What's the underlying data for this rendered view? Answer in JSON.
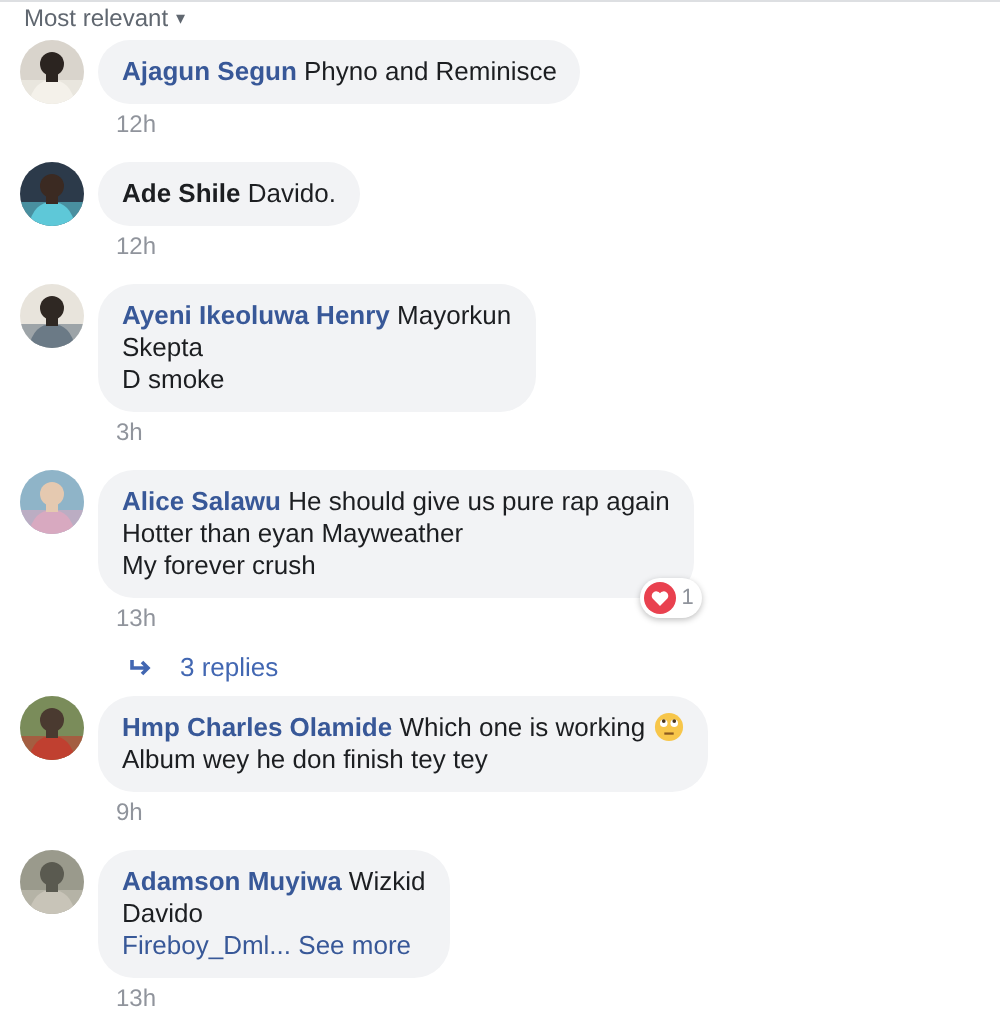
{
  "sort_menu": {
    "label": "Most relevant",
    "caret": "▾"
  },
  "comments": [
    {
      "author": "Ajagun Segun",
      "name_linked": true,
      "lines": [
        "Phyno and Reminisce"
      ],
      "time": "12h",
      "avatar": {
        "kind": "picture"
      }
    },
    {
      "author": "Ade Shile",
      "name_linked": false,
      "lines": [
        "Davido."
      ],
      "time": "12h",
      "avatar": {
        "kind": "picture"
      }
    },
    {
      "author": "Ayeni Ikeoluwa Henry",
      "name_linked": true,
      "lines": [
        "Mayorkun",
        "Skepta",
        "D smoke"
      ],
      "time": "3h",
      "avatar": {
        "kind": "picture"
      }
    },
    {
      "author": "Alice Salawu",
      "name_linked": true,
      "lines": [
        "He should give us pure rap again",
        "Hotter than eyan Mayweather",
        "My forever crush"
      ],
      "time": "13h",
      "reaction": {
        "count": "1"
      },
      "replies": "3 replies",
      "avatar": {
        "kind": "picture"
      }
    },
    {
      "author": "Hmp Charles Olamide",
      "name_linked": true,
      "lines": [
        "Which one is working",
        "Album wey he don finish tey tey"
      ],
      "emoji_after_first_line": true,
      "time": "9h",
      "avatar": {
        "kind": "picture"
      }
    },
    {
      "author": "Adamson Muyiwa",
      "name_linked": true,
      "lines": [
        "Wizkid",
        "Davido"
      ],
      "truncated": {
        "mention": "Fireboy_Dml...",
        "link": "See more"
      },
      "time": "13h",
      "avatar": {
        "kind": "picture"
      }
    }
  ]
}
